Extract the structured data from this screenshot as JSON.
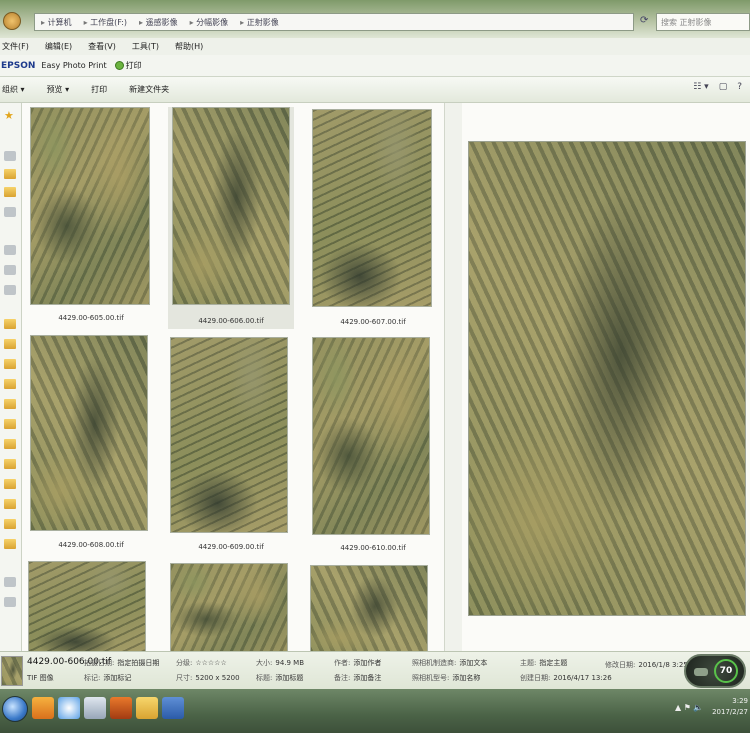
{
  "address": {
    "crumbs": [
      "计算机",
      "工作盘(F:)",
      "遥感影像",
      "分幅影像",
      "正射影像"
    ],
    "search_placeholder": "搜索 正射影像"
  },
  "menu": [
    "文件(F)",
    "编辑(E)",
    "查看(V)",
    "工具(T)",
    "帮助(H)"
  ],
  "epson": {
    "logo": "EPSON",
    "app": "Easy Photo Print",
    "print": "打印"
  },
  "toolbar": {
    "organize": "组织 ▾",
    "preview": "预览 ▾",
    "print": "打印",
    "new_folder": "新建文件夹"
  },
  "toolbar_right": {
    "view": "☷ ▾",
    "pane": "▢",
    "help": "?"
  },
  "thumbnails": [
    {
      "label": "4429.00-605.00.tif"
    },
    {
      "label": "4429.00-606.00.tif"
    },
    {
      "label": "4429.00-607.00.tif"
    },
    {
      "label": "4429.00-608.00.tif"
    },
    {
      "label": "4429.00-609.00.tif"
    },
    {
      "label": "4429.00-610.00.tif"
    },
    {
      "label": ""
    },
    {
      "label": ""
    },
    {
      "label": ""
    }
  ],
  "details": {
    "name": "4429.00-606.00.tif",
    "type": "TIF 图像",
    "fields": [
      {
        "label": "拍摄日期:",
        "value": "指定拍摄日期"
      },
      {
        "label": "标记:",
        "value": "添加标记"
      },
      {
        "label": "分级:",
        "value": "☆☆☆☆☆"
      },
      {
        "label": "尺寸:",
        "value": "5200 x 5200"
      },
      {
        "label": "大小:",
        "value": "94.9 MB"
      },
      {
        "label": "标题:",
        "value": "添加标题"
      },
      {
        "label": "作者:",
        "value": "添加作者"
      },
      {
        "label": "备注:",
        "value": "添加备注"
      },
      {
        "label": "照相机制造商:",
        "value": "添加文本"
      },
      {
        "label": "照相机型号:",
        "value": "添加名称"
      },
      {
        "label": "主题:",
        "value": "指定主题"
      },
      {
        "label": "创建日期:",
        "value": "2016/4/17 13:26"
      },
      {
        "label": "修改日期:",
        "value": "2016/1/8 3:25"
      }
    ],
    "gauge_value": "70"
  },
  "taskbar": {
    "clock_time": "3:29",
    "clock_date": "2017/2/27",
    "tray": "▲ ⚑ 🔈"
  }
}
